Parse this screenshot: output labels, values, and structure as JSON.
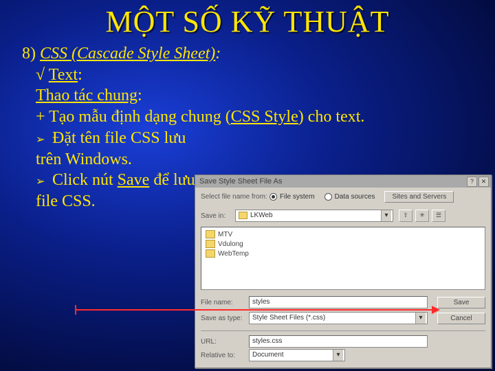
{
  "title": "MỘT SỐ KỸ THUẬT",
  "heading_num": "8) ",
  "heading_text": "CSS (Cascade Style Sheet)",
  "heading_colon": ":",
  "check": "√ ",
  "sub1": "Text",
  "sub2": "Thao tác chung",
  "line3a": "+ Tạo mẫu định dạng chung (",
  "line3b": "CSS Style",
  "line3c": ") cho text.",
  "bullet_char": "➢",
  "b1": " Đặt tên file CSS lưu trên Windows.",
  "b2a": " Click nút ",
  "b2b": "Save",
  "b2c": " để lưu file CSS.",
  "dialog": {
    "title": "Save Style Sheet File As",
    "select_label": "Select file name from:",
    "r1": "File system",
    "r2": "Data sources",
    "sites_btn": "Sites and Servers",
    "savein_label": "Save in:",
    "savein_value": "LKWeb",
    "folders": [
      "MTV",
      "Vdulong",
      "WebTemp"
    ],
    "filename_label": "File name:",
    "filename_value": "styles",
    "save_btn": "Save",
    "saveas_label": "Save as type:",
    "saveas_value": "Style Sheet Files (*.css)",
    "cancel_btn": "Cancel",
    "url_label": "URL:",
    "url_value": "styles.css",
    "rel_label": "Relative to:",
    "rel_value": "Document"
  }
}
